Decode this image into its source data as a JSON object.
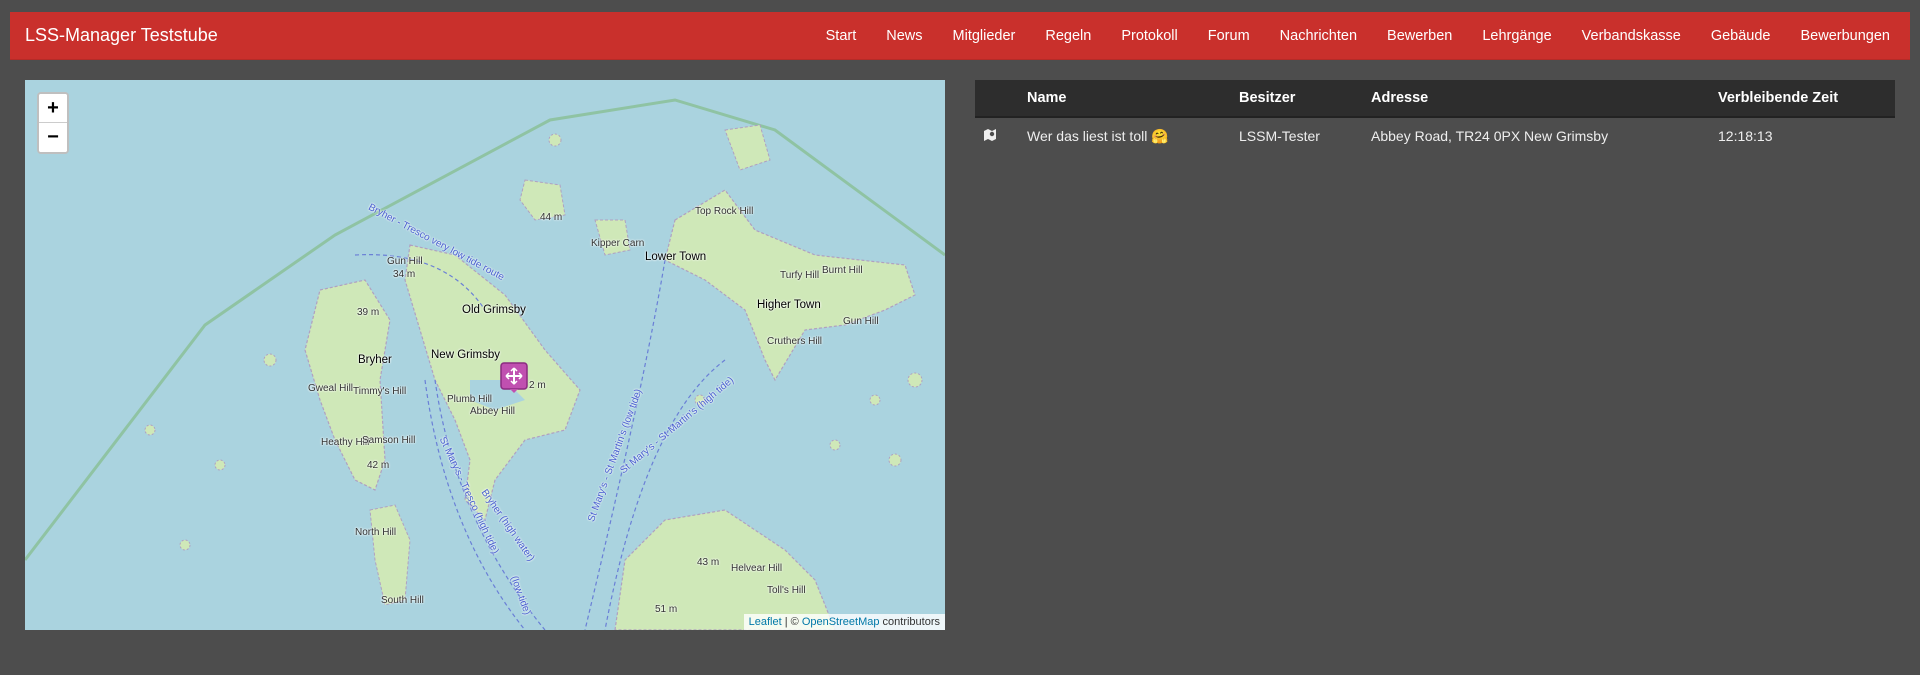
{
  "navbar": {
    "brand": "LSS-Manager Teststube",
    "items": [
      "Start",
      "News",
      "Mitglieder",
      "Regeln",
      "Protokoll",
      "Forum",
      "Nachrichten",
      "Bewerben",
      "Lehrgänge",
      "Verbandskasse",
      "Gebäude",
      "Bewerbungen"
    ]
  },
  "map": {
    "zoom_in": "+",
    "zoom_out": "−",
    "attribution": {
      "leaflet": "Leaflet",
      "separator": " | © ",
      "osm": "OpenStreetMap",
      "suffix": " contributors"
    },
    "labels": {
      "lower_town": "Lower Town",
      "higher_town": "Higher Town",
      "old_grimsby": "Old Grimsby",
      "new_grimsby": "New Grimsby",
      "bryher": "Bryher",
      "gun_hill": "Gun Hill",
      "gun_hill_height": "34 m",
      "gun_hill_east": "Gun Hill",
      "top_rock_hill": "Top Rock Hill",
      "kipper_carn": "Kipper Carn",
      "turfy_hill": "Turfy Hill",
      "burnt_hill": "Burnt Hill",
      "cruthers_hill": "Cruthers Hill",
      "h44": "44 m",
      "h39": "39 m",
      "gweal_hill": "Gweal Hill",
      "timmys_hill": "Timmy's Hill",
      "heathy_hill": "Heathy Hill",
      "samson_hill": "Samson Hill",
      "h42": "42 m",
      "plumb_hill": "Plumb Hill",
      "abbey_hill": "Abbey Hill",
      "h2": "2 m",
      "north_hill": "North Hill",
      "south_hill": "South Hill",
      "h43": "43 m",
      "helvear_hill": "Helvear Hill",
      "tolls_hill": "Toll's Hill",
      "h51": "51 m",
      "route_bryher_tresco": "Bryher - Tresco very low tide route",
      "route_stmarys_low": "St Mary's - St Martin's (low tide)",
      "route_stmarys_high": "St Mary's - St Martin's (high tide)",
      "route_tresco_high": "St Mary's - Tresco (high tide)",
      "route_bryher_high": "Bryher (high water)",
      "route_low_tide": "(low tide)"
    }
  },
  "table": {
    "headers": [
      "",
      "Name",
      "Besitzer",
      "Adresse",
      "Verbleibende Zeit"
    ],
    "rows": [
      {
        "icon": "map-marker-icon",
        "name": "Wer das liest ist toll 🤗",
        "owner": "LSSM-Tester",
        "address": "Abbey Road, TR24 0PX New Grimsby",
        "remaining": "12:18:13"
      }
    ]
  }
}
